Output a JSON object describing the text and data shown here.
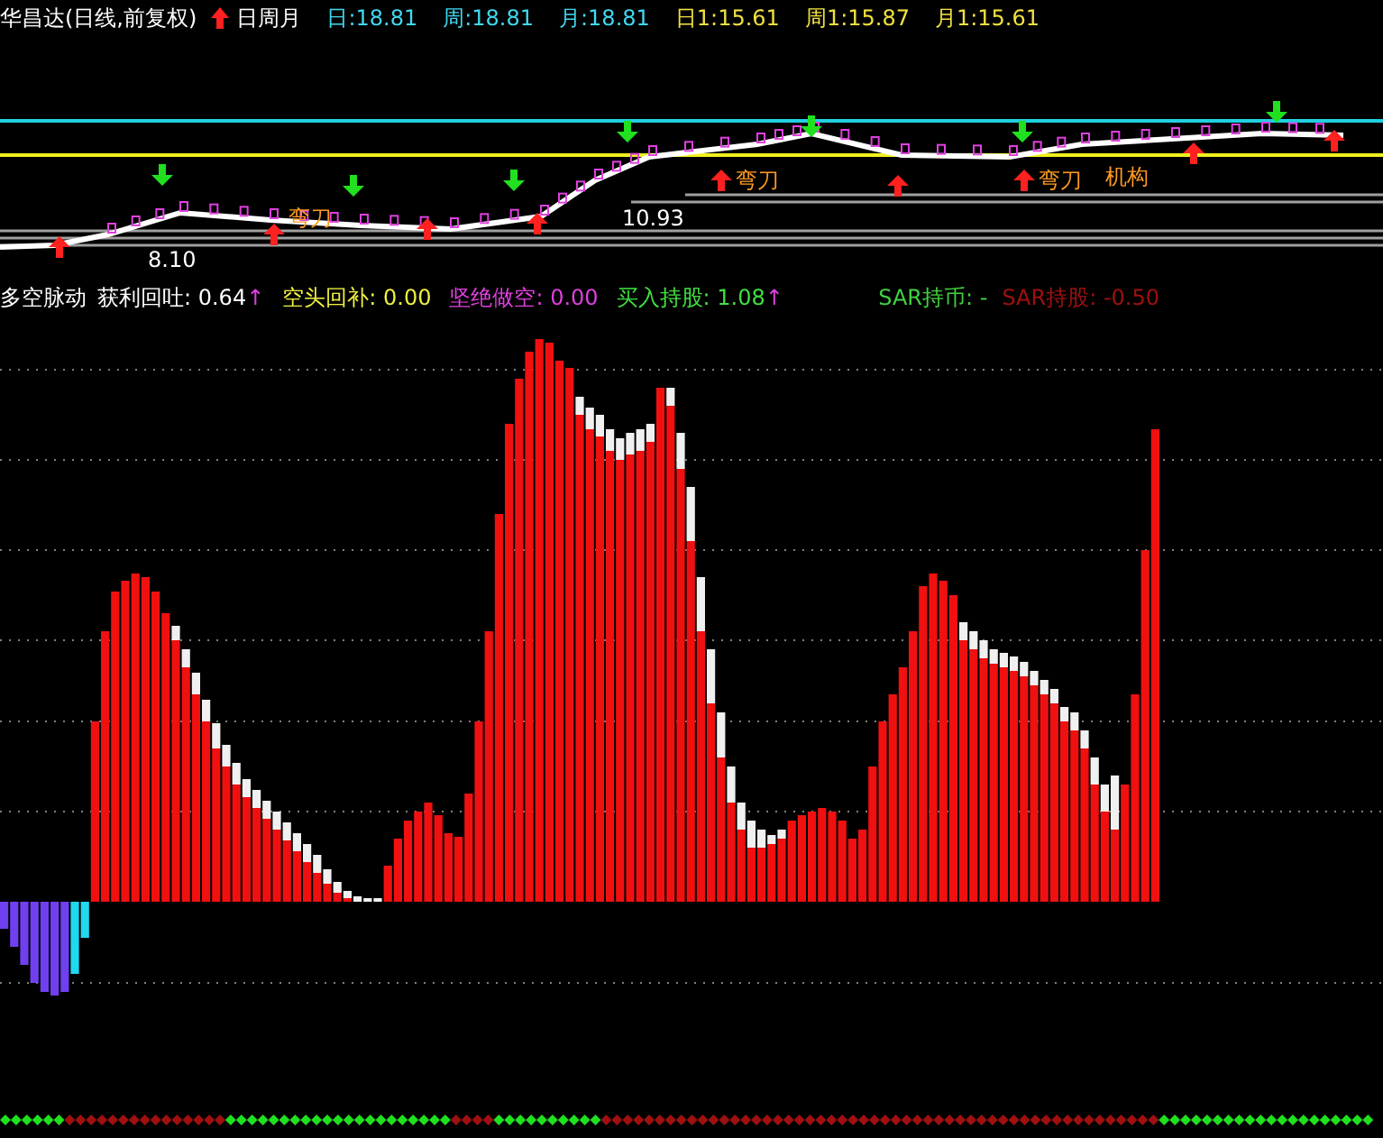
{
  "header": {
    "title": "华昌达(日线,前复权)",
    "mode": "日周月",
    "values": [
      {
        "text": "日:18.81",
        "color": "#40d8f0"
      },
      {
        "text": "周:18.81",
        "color": "#40d8f0"
      },
      {
        "text": "月:18.81",
        "color": "#40d8f0"
      },
      {
        "text": "日1:15.61",
        "color": "#f0e040"
      },
      {
        "text": "周1:15.87",
        "color": "#f0e040"
      },
      {
        "text": "月1:15.61",
        "color": "#f0e040"
      }
    ]
  },
  "price_panel": {
    "labels": [
      {
        "kind": "tag",
        "text": "弯刀"
      },
      {
        "kind": "tag",
        "text": "弯刀"
      },
      {
        "kind": "tag",
        "text": "弯刀"
      },
      {
        "kind": "tag",
        "text": "机构"
      },
      {
        "kind": "price",
        "text": "10.93"
      },
      {
        "kind": "price",
        "text": "8.10"
      }
    ]
  },
  "indicator": {
    "name": "多空脉动",
    "items": [
      {
        "text": "获利回吐: 0.64",
        "color": "#ffffff",
        "arrow": "↑"
      },
      {
        "text": "空头回补: 0.00",
        "color": "#f0f040"
      },
      {
        "text": "坚绝做空: 0.00",
        "color": "#e040e0"
      },
      {
        "text": "买入持股: 1.08",
        "color": "#40e040",
        "arrow": "↑"
      }
    ],
    "sar": [
      {
        "text": "SAR持币: -",
        "color": "#40d040"
      },
      {
        "text": "SAR持股: -0.50",
        "color": "#a01010"
      }
    ]
  }
}
